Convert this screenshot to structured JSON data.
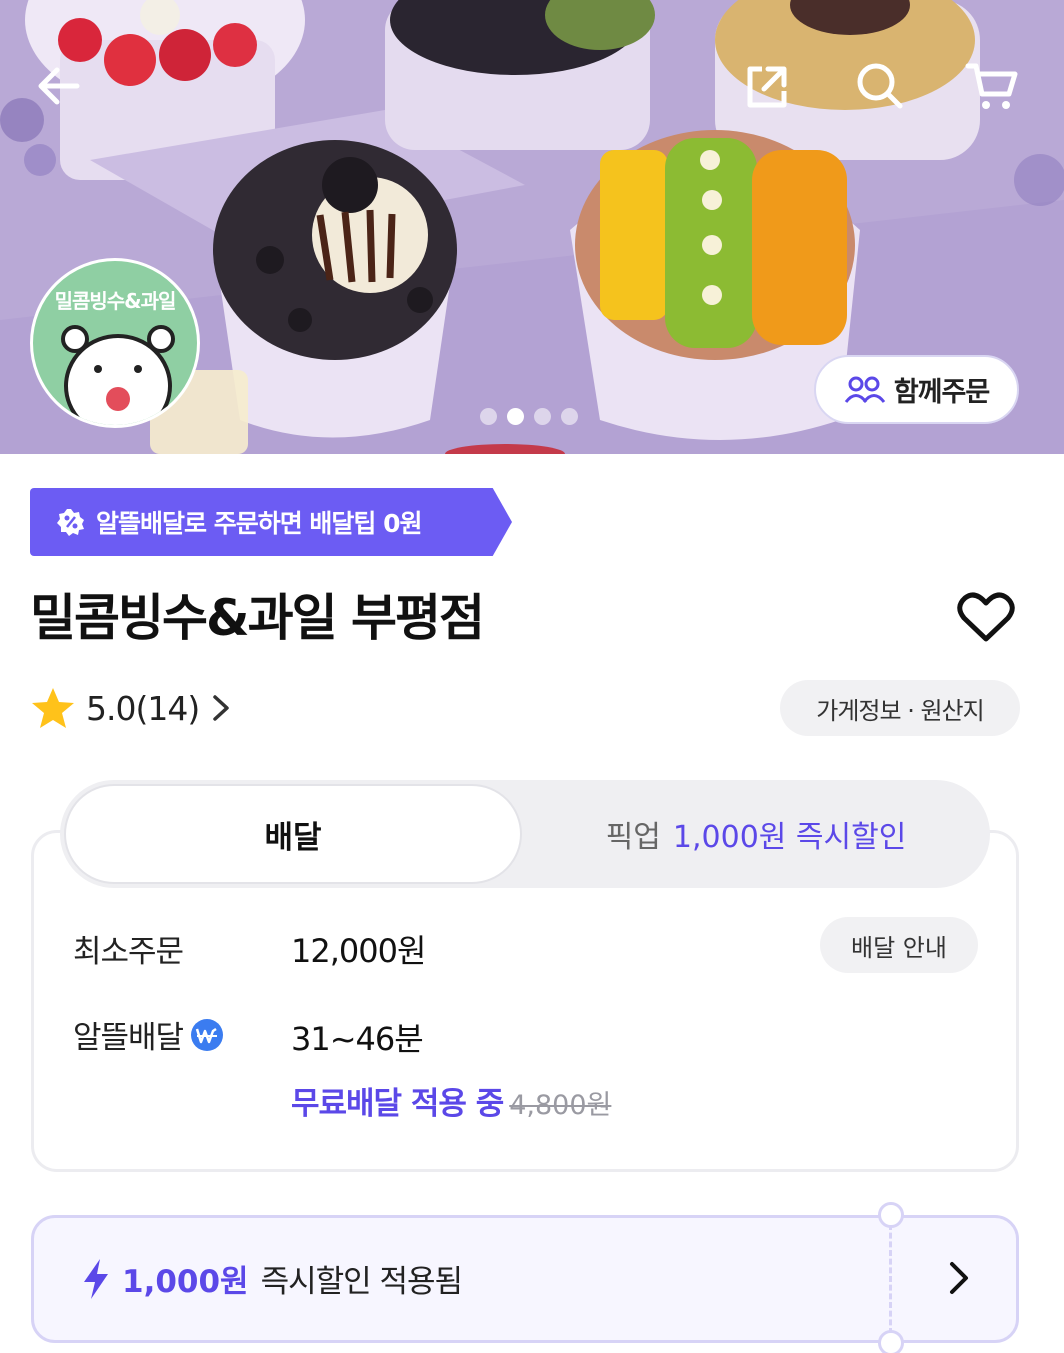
{
  "hero": {
    "logo_text": "밀콤빙수&과일",
    "group_order_label": "함께주문",
    "carousel_total": 4,
    "carousel_active": 2
  },
  "promo": {
    "text": "알뜰배달로 주문하면 배달팁 0원",
    "color": "#6c5cf3"
  },
  "store": {
    "name": "밀콤빙수&과일 부평점",
    "rating": "5.0(14)",
    "info_label": "가게정보 · 원산지"
  },
  "tabs": {
    "delivery_label": "배달",
    "pickup_label": "픽업",
    "pickup_discount": "1,000원 즉시할인"
  },
  "delivery": {
    "min_order_label": "최소주문",
    "min_order_value": "12,000원",
    "guide_label": "배달 안내",
    "saver_label": "알뜰배달",
    "saver_time": "31~46분",
    "free_label": "무료배달 적용 중",
    "original_fee": "4,800원"
  },
  "coupon": {
    "amount": "1,000원",
    "text": "즉시할인 적용됨"
  },
  "colors": {
    "accent": "#5b48e8",
    "star": "#ffc21a"
  }
}
